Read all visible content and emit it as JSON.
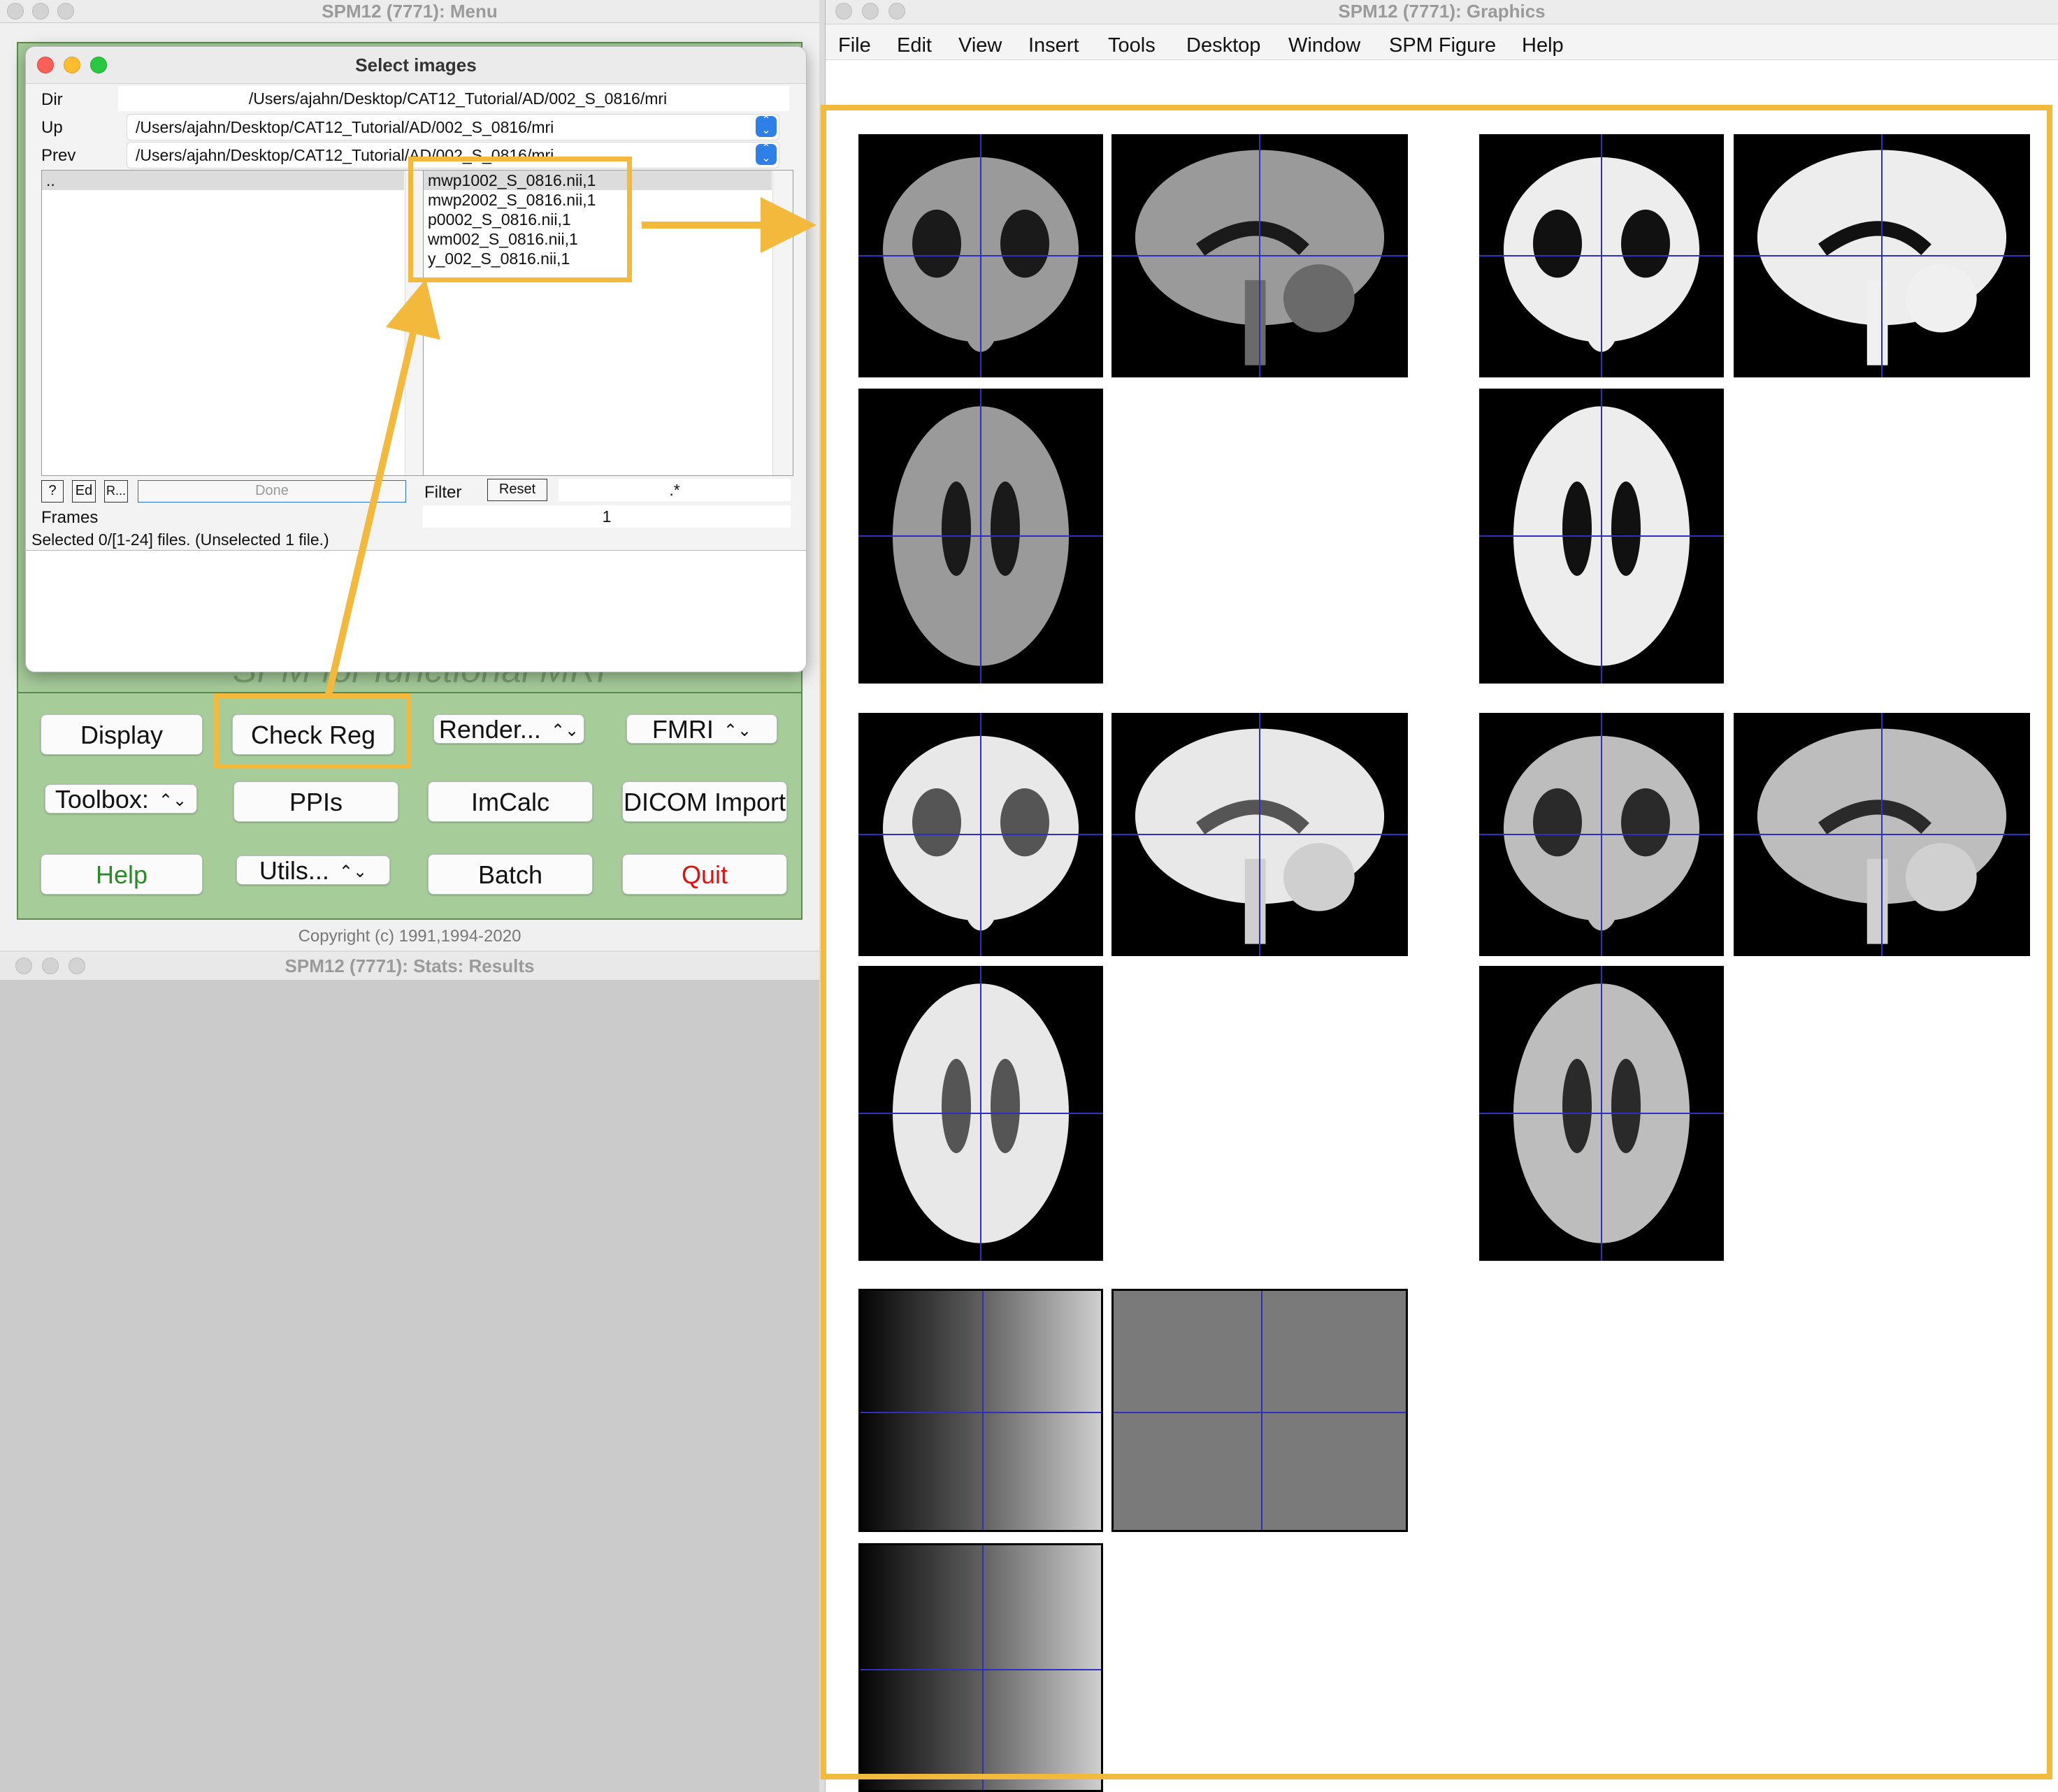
{
  "menu_window": {
    "title": "SPM12 (7771): Menu",
    "watermark": "SPM for functional MRI",
    "copyright": "Copyright (c) 1991,1994-2020",
    "buttons": {
      "display": "Display",
      "check_reg": "Check Reg",
      "render": "Render...",
      "fmri": "FMRI",
      "toolbox": "Toolbox:",
      "ppis": "PPIs",
      "imcalc": "ImCalc",
      "dicom_import": "DICOM Import",
      "help": "Help",
      "utils": "Utils...",
      "batch": "Batch",
      "quit": "Quit"
    },
    "colors": {
      "help_text": "#2a8a2a",
      "quit_text": "#e01010",
      "panel": "#a6cc9a"
    }
  },
  "select_dialog": {
    "title": "Select images",
    "dir_label": "Dir",
    "dir_value": "/Users/ajahn/Desktop/CAT12_Tutorial/AD/002_S_0816/mri",
    "up_label": "Up",
    "up_value": "/Users/ajahn/Desktop/CAT12_Tutorial/AD/002_S_0816/mri",
    "prev_label": "Prev",
    "prev_value": "/Users/ajahn/Desktop/CAT12_Tutorial/AD/002_S_0816/mri",
    "dir_list": [
      ".."
    ],
    "files": [
      "mwp1002_S_0816.nii,1",
      "mwp2002_S_0816.nii,1",
      "p0002_S_0816.nii,1",
      "wm002_S_0816.nii,1",
      "y_002_S_0816.nii,1"
    ],
    "help_btn": "?",
    "ed_btn": "Ed",
    "r_btn": "R...",
    "done_btn": "Done",
    "filter_label": "Filter",
    "reset_btn": "Reset",
    "filter_value": ".*",
    "frames_label": "Frames",
    "frames_value": "1",
    "status": "Selected 0/[1-24] files. (Unselected 1 file.)"
  },
  "stats_window": {
    "title": "SPM12 (7771): Stats: Results"
  },
  "graphics_window": {
    "title": "SPM12 (7771): Graphics",
    "menu": [
      "File",
      "Edit",
      "View",
      "Insert",
      "Tools",
      "Desktop",
      "Window",
      "SPM Figure",
      "Help"
    ]
  },
  "highlight_color": "#f2b93c"
}
